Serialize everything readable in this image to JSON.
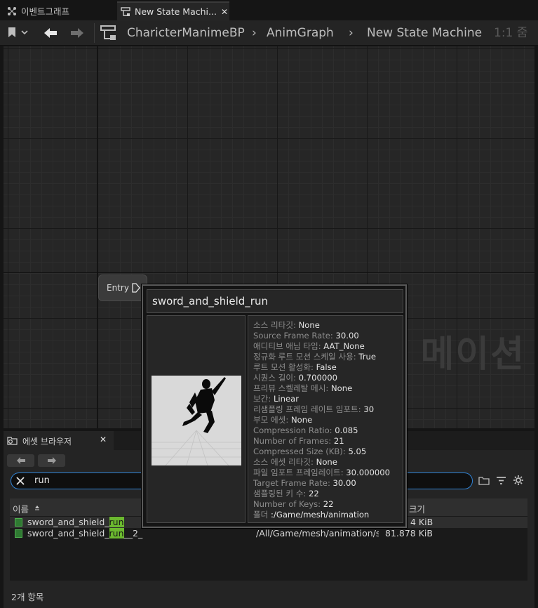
{
  "tabs": [
    {
      "label": "이벤트그래프"
    },
    {
      "label": "New State Machi..."
    }
  ],
  "breadcrumb": {
    "items": [
      "CharicterManimeBP",
      "AnimGraph",
      "New State Machine"
    ],
    "zoom": "1:1 줌"
  },
  "graph": {
    "watermark": "메이션",
    "entry_label": "Entry"
  },
  "asset_browser": {
    "title": "에셋 브라우저",
    "search_value": "run",
    "columns": {
      "name": "이름",
      "size": "크기"
    },
    "rows": [
      {
        "name_prefix": "sword_and_shield_",
        "name_match": "run",
        "name_suffix": "",
        "path": "",
        "size": "4 KiB"
      },
      {
        "name_prefix": "sword_and_shield_",
        "name_match": "run",
        "name_suffix": "__2_",
        "path": "/All/Game/mesh/animation/sw",
        "size": "81.878 KiB"
      }
    ],
    "status": "2개 항목"
  },
  "tooltip": {
    "title": "sword_and_shield_run",
    "properties": [
      {
        "key": "소스 리타깃:",
        "value": "None"
      },
      {
        "key": "Source Frame Rate:",
        "value": "30.00"
      },
      {
        "key": "애디티브 애님 타입:",
        "value": "AAT_None"
      },
      {
        "key": "정규화 루트 모션 스케일 사용:",
        "value": "True"
      },
      {
        "key": "루트 모션 활성화:",
        "value": "False"
      },
      {
        "key": "시퀀스 길이:",
        "value": "0.700000"
      },
      {
        "key": "프리뷰 스켈레탈 메시:",
        "value": "None"
      },
      {
        "key": "보간:",
        "value": "Linear"
      },
      {
        "key": "리샘플링 프레임 레이트 임포트:",
        "value": "30"
      },
      {
        "key": "부모 에셋:",
        "value": "None"
      },
      {
        "key": "Compression Ratio:",
        "value": "0.085"
      },
      {
        "key": "Number of Frames:",
        "value": "21"
      },
      {
        "key": "Compressed Size (KB):",
        "value": "5.05"
      },
      {
        "key": "소스 에셋 리타깃:",
        "value": "None"
      },
      {
        "key": "파일 임포트 프레임레이트:",
        "value": "30.000000"
      },
      {
        "key": "Target Frame Rate:",
        "value": "30.00"
      },
      {
        "key": "샘플링된 키 수:",
        "value": "22"
      },
      {
        "key": "Number of Keys:",
        "value": "22"
      },
      {
        "key": "폴더",
        "value": ":/Game/mesh/animation"
      }
    ]
  },
  "colors": {
    "accent": "#2f84d8",
    "search_highlight": "#6bb82f",
    "asset_icon": "#2f7a32"
  }
}
